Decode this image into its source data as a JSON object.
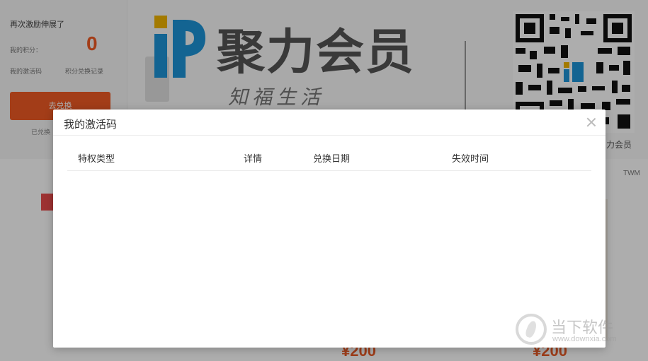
{
  "background": {
    "left_panel": {
      "notice": "再次激励伸展了",
      "points_label": "我的积分：",
      "count": "0",
      "link_a": "我的激活码",
      "link_b": "积分兑换记录",
      "action_button": "去兑换",
      "footnote": "已兑换"
    },
    "brand_name": "聚力会员",
    "slogan": "知福生活",
    "qr_caption": "力会员",
    "side_label": "TWM",
    "price_a": "¥200",
    "price_b": "¥200",
    "colors": {
      "accent": "#f15a24",
      "brand_blue": "#1c94d8",
      "brand_gold": "#f0b400"
    }
  },
  "modal": {
    "title": "我的激活码",
    "close_icon": "close-icon",
    "columns": [
      "特权类型",
      "详情",
      "兑换日期",
      "失效时间"
    ],
    "rows": []
  },
  "watermark": {
    "name": "当下软件",
    "url": "www.downxia.com"
  }
}
